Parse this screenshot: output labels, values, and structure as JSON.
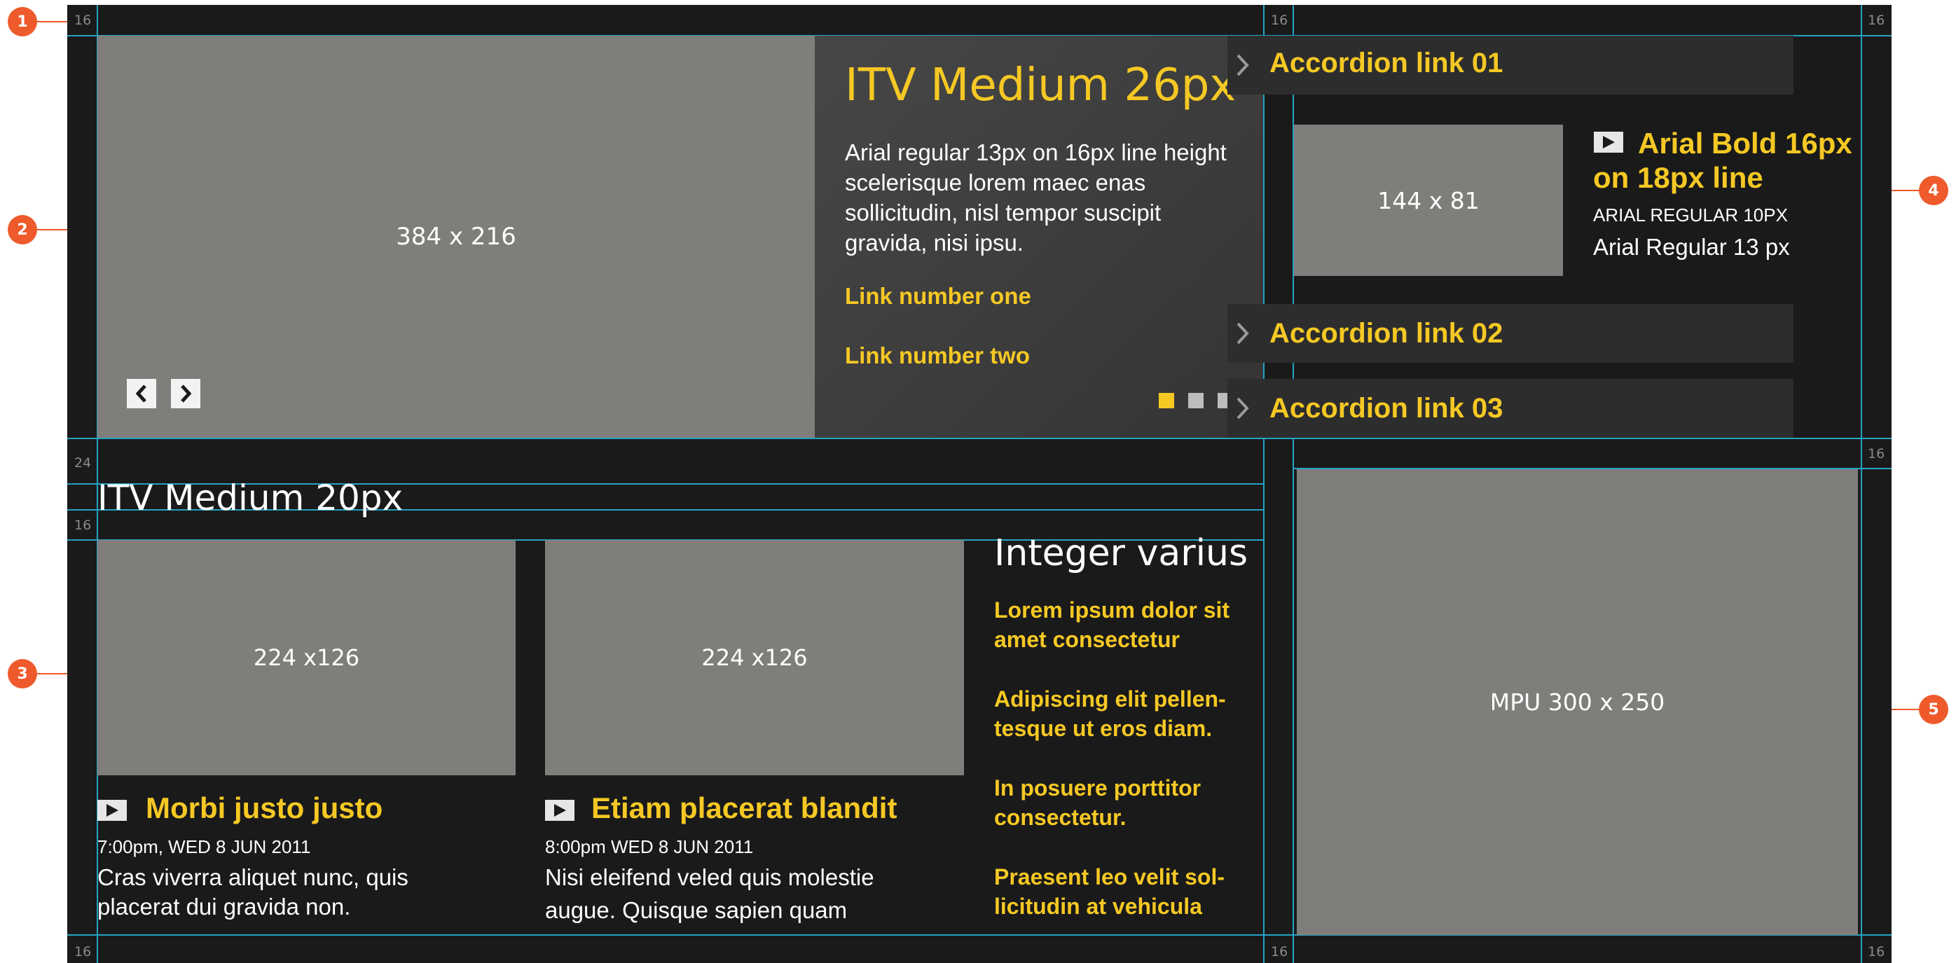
{
  "guides": {
    "top_left": "16",
    "top_mid": "16",
    "top_right": "16",
    "left_24": "24",
    "left_16": "16",
    "right_16": "16",
    "bottom_left": "16",
    "bottom_mid": "16",
    "bottom_right": "16"
  },
  "markers": [
    "1",
    "2",
    "3",
    "4",
    "5"
  ],
  "hero": {
    "image_label": "384 x 216",
    "title": "ITV Medium 26px",
    "body": "Arial regular 13px on 16px line height scelerisque lorem maec enas sollicitudin, nisl tempor suscipit gravida, nisi ipsu.",
    "links": [
      "Link number one",
      "Link number two"
    ],
    "prev_icon": "chevron-left-icon",
    "next_icon": "chevron-right-icon",
    "pagination": {
      "count": 3,
      "active_index": 0
    }
  },
  "accordion": {
    "items": [
      {
        "label": "Accordion link 01",
        "expanded": true
      },
      {
        "label": "Accordion link 02",
        "expanded": false
      },
      {
        "label": "Accordion link 03",
        "expanded": false
      }
    ],
    "panel": {
      "image_label": "144 x 81",
      "title": "Arial Bold 16px on 18px line",
      "caption": "ARIAL REGULAR 10PX",
      "text": "Arial Regular 13 px"
    }
  },
  "section": {
    "title": "ITV Medium 20px",
    "cards": [
      {
        "image_label": "224 x126",
        "title": "Morbi justo justo",
        "meta": "7:00pm, WED 8 JUN 2011",
        "desc_line1": "Cras viverra aliquet nunc, quis",
        "desc_line2": "placerat dui gravida non."
      },
      {
        "image_label": "224 x126",
        "title": "Etiam placerat blandit",
        "meta": "8:00pm WED 8 JUN 2011",
        "desc_line1": "Nisi eleifend veled quis molestie",
        "desc_line2": "augue. Quisque sapien quam"
      }
    ],
    "list": {
      "title": "Integer varius",
      "items": [
        "Lorem ipsum dolor sit amet consectetur",
        "Adipiscing elit pellen-tesque ut eros diam.",
        "In posuere porttitor consectetur.",
        "Praesent leo velit sol-licitudin at vehicula"
      ]
    }
  },
  "mpu": {
    "label": "MPU 300 x 250"
  },
  "colors": {
    "accent": "#f5c824",
    "background": "#1a1a1a",
    "panel": "#3a3a3a",
    "placeholder": "#7f7e7b",
    "guide": "#25a3c4",
    "marker": "#ee5a2b"
  }
}
